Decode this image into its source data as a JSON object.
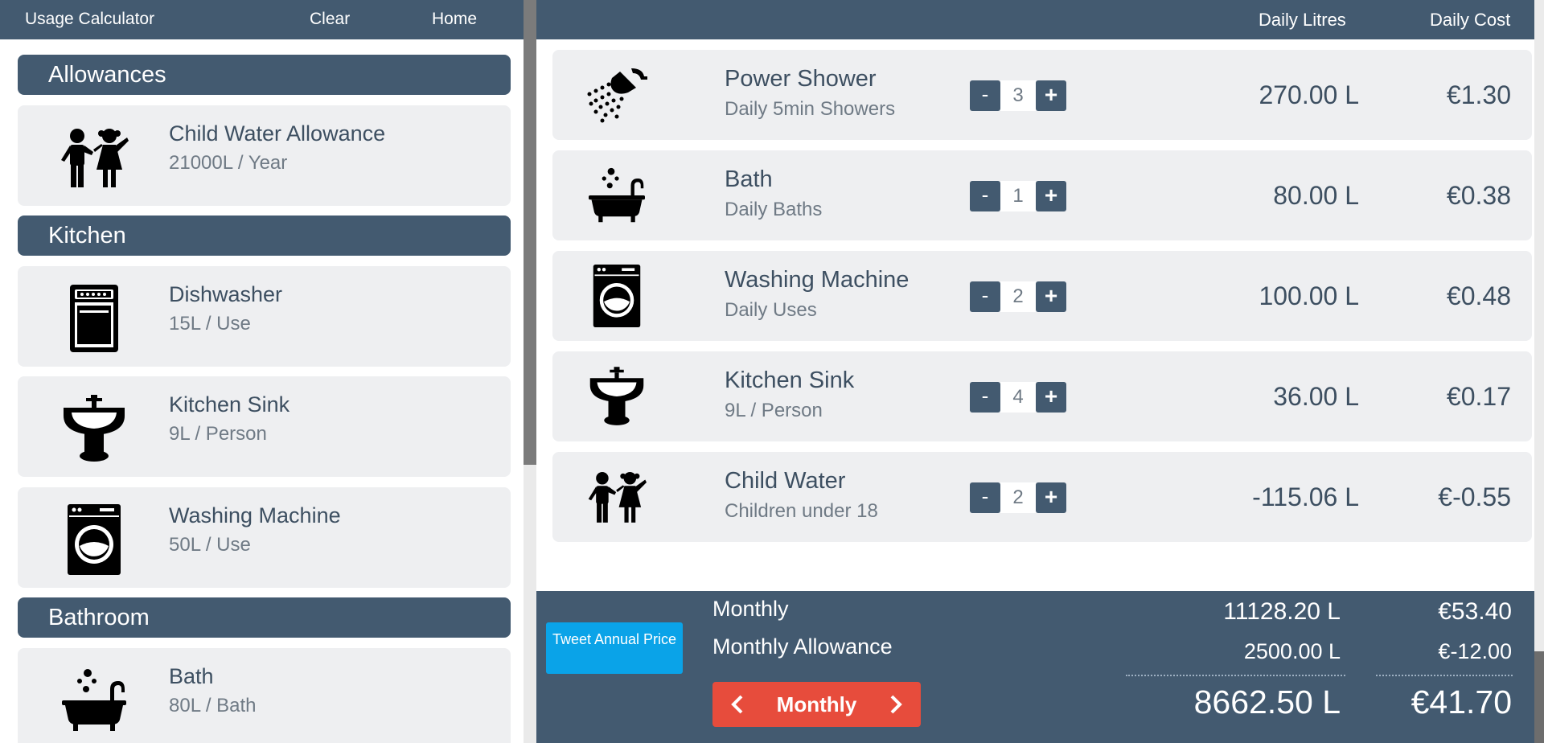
{
  "left": {
    "nav": {
      "title": "Usage Calculator",
      "clear": "Clear",
      "home": "Home"
    },
    "sections": [
      {
        "header": "Allowances",
        "items": [
          {
            "icon": "children-icon",
            "title": "Child Water Allowance",
            "sub": "21000L / Year"
          }
        ]
      },
      {
        "header": "Kitchen",
        "items": [
          {
            "icon": "dishwasher-icon",
            "title": "Dishwasher",
            "sub": "15L / Use"
          },
          {
            "icon": "sink-icon",
            "title": "Kitchen Sink",
            "sub": "9L / Person"
          },
          {
            "icon": "washing-machine-icon",
            "title": "Washing Machine",
            "sub": "50L / Use"
          }
        ]
      },
      {
        "header": "Bathroom",
        "items": [
          {
            "icon": "bath-icon",
            "title": "Bath",
            "sub": "80L / Bath"
          }
        ]
      }
    ]
  },
  "right": {
    "header": {
      "litres": "Daily Litres",
      "cost": "Daily Cost"
    },
    "rows": [
      {
        "icon": "shower-icon",
        "title": "Power Shower",
        "sub": "Daily 5min Showers",
        "qty": "3",
        "litres": "270.00 L",
        "cost": "€1.30"
      },
      {
        "icon": "bath-icon",
        "title": "Bath",
        "sub": "Daily Baths",
        "qty": "1",
        "litres": "80.00 L",
        "cost": "€0.38"
      },
      {
        "icon": "washing-machine-icon",
        "title": "Washing Machine",
        "sub": "Daily Uses",
        "qty": "2",
        "litres": "100.00 L",
        "cost": "€0.48"
      },
      {
        "icon": "sink-icon",
        "title": "Kitchen Sink",
        "sub": "9L / Person",
        "qty": "4",
        "litres": "36.00 L",
        "cost": "€0.17"
      },
      {
        "icon": "children-icon",
        "title": "Child Water",
        "sub": "Children under 18",
        "qty": "2",
        "litres": "-115.06 L",
        "cost": "€-0.55"
      }
    ],
    "stepper": {
      "minus": "-",
      "plus": "+"
    }
  },
  "footer": {
    "tweet": "Tweet Annual Price",
    "monthly_label": "Monthly",
    "allowance_label": "Monthly Allowance",
    "monthly_litres": "11128.20 L",
    "monthly_cost": "€53.40",
    "allowance_litres": "2500.00 L",
    "allowance_cost": "€-12.00",
    "total_litres": "8662.50 L",
    "total_cost": "€41.70",
    "period": "Monthly"
  },
  "colors": {
    "header": "#435a70",
    "card": "#eeeff1",
    "tweet": "#0aa3e8",
    "period": "#e74c3c"
  }
}
